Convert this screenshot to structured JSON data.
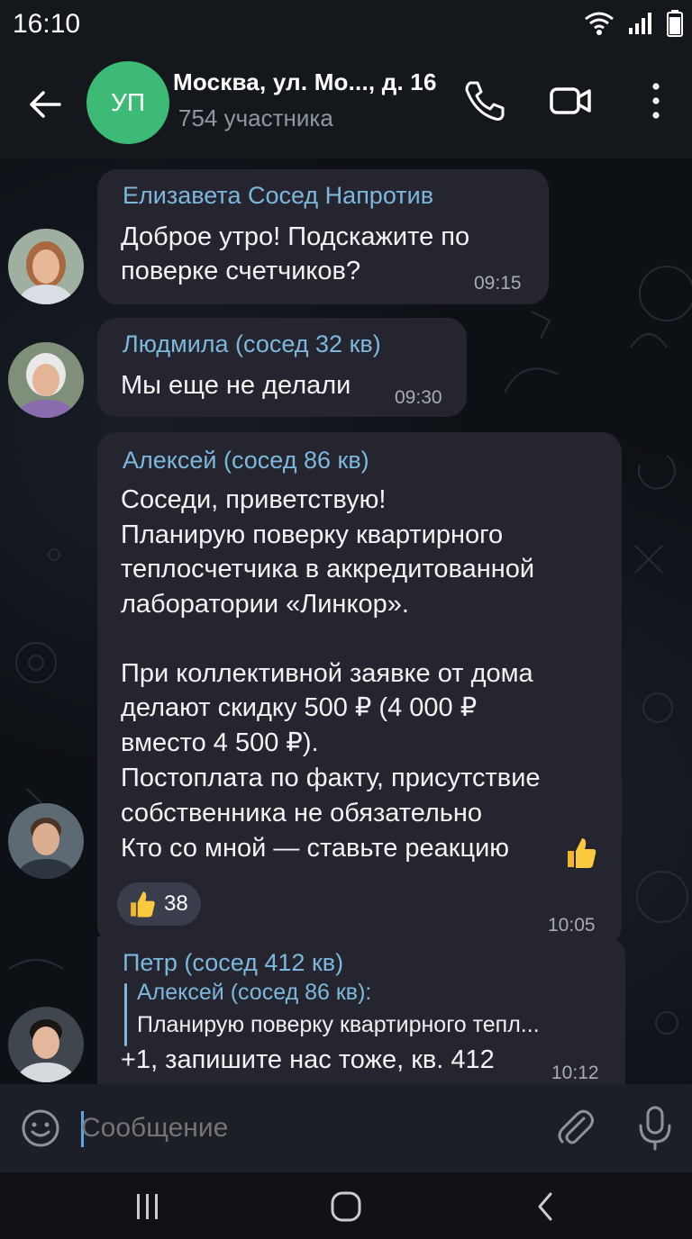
{
  "status_bar": {
    "time": "16:10",
    "icons": [
      "wifi-icon",
      "signal-icon",
      "battery-icon"
    ]
  },
  "header": {
    "avatar_initials": "УП",
    "title": "Москва, ул. Мо..., д. 16",
    "subtitle": "754 участника",
    "avatar_color": "#3dbb76"
  },
  "messages": [
    {
      "sender": "Елизавета Сосед Напротив",
      "lines": [
        "Доброе утро! Подскажите по",
        "поверке счетчиков?"
      ],
      "time": "09:15"
    },
    {
      "sender": "Людмила (сосед 32 кв)",
      "lines": [
        "Мы еще не делали"
      ],
      "time": "09:30"
    },
    {
      "sender": "Алексей (сосед 86 кв)",
      "lines": [
        "Соседи, приветствую!",
        "Планирую поверку квартирного",
        "теплосчетчика в аккредитованной",
        "лаборатории «Линкор».",
        "",
        "При коллективной заявке от дома",
        "делают скидку 500 ₽ (4 000 ₽",
        "вместо 4 500 ₽).",
        "Постоплата по факту, присутствие",
        "собственника не обязательно",
        "Кто со мной — ставьте реакцию"
      ],
      "reaction": {
        "icon": "thumbs-up-icon",
        "count": "38"
      },
      "time": "10:05"
    },
    {
      "sender": "Петр (сосед 412 кв)",
      "reply": {
        "sender": "Алексей (сосед 86 кв):",
        "text": "Планирую поверку квартирного тепл..."
      },
      "lines": [
        "+1, запишите нас тоже, кв. 412"
      ],
      "time": "10:12"
    }
  ],
  "input": {
    "placeholder": "Сообщение"
  },
  "colors": {
    "accent": "#7db8dc",
    "bubble": "#24252f",
    "background": "#0d1015"
  }
}
